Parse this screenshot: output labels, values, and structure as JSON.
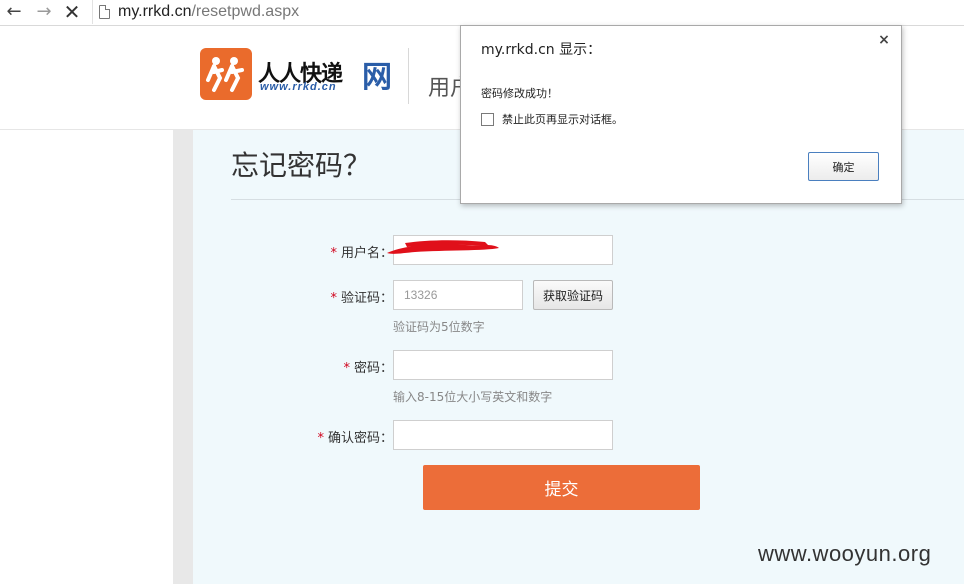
{
  "browser": {
    "url_domain": "my.rrkd.cn",
    "url_path": "/resetpwd.aspx",
    "back_glyph": "←",
    "forward_glyph": "→",
    "stop_glyph": "✕"
  },
  "header": {
    "logo_text": "人人快递",
    "logo_net": "网",
    "logo_url": "www.rrkd.cn",
    "section_title": "用户中心"
  },
  "form": {
    "page_title": "忘记密码？",
    "required_mark": "*",
    "username_label": "用户名：",
    "code_label": "验证码：",
    "code_value": "13326",
    "code_button": "获取验证码",
    "code_hint": "验证码为5位数字",
    "password_label": "密码：",
    "password_hint": "输入8-15位大小写英文和数字",
    "confirm_label": "确认密码：",
    "submit_label": "提交"
  },
  "dialog": {
    "title": "my.rrkd.cn 显示：",
    "message": "密码修改成功！",
    "checkbox_label": "禁止此页再显示对话框。",
    "ok_label": "确定",
    "close_glyph": "×"
  },
  "watermark": "www.wooyun.org",
  "colors": {
    "accent": "#ec6d39",
    "logo_orange": "#ea6b2c",
    "logo_blue": "#2a5da8",
    "required": "#d0021b",
    "panel_bg": "#f0f9fc",
    "redaction": "#e0101a"
  }
}
